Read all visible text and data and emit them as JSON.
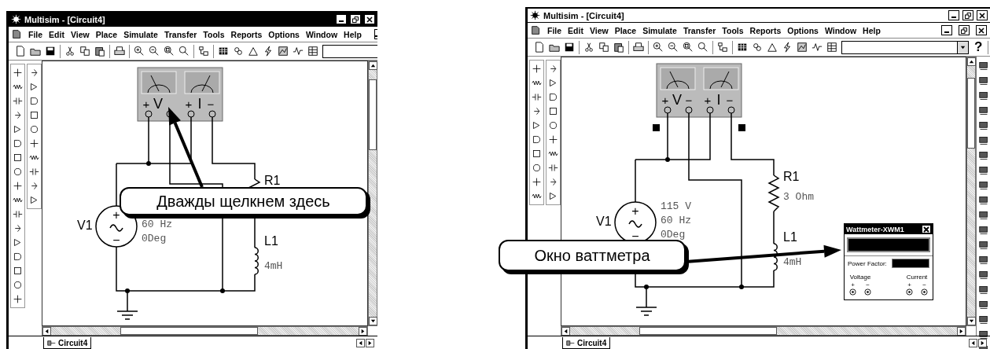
{
  "panels": [
    {
      "active": true,
      "title": "Multisim - [Circuit4]",
      "menu": [
        "File",
        "Edit",
        "View",
        "Place",
        "Simulate",
        "Transfer",
        "Tools",
        "Reports",
        "Options",
        "Window",
        "Help"
      ],
      "meter": {
        "selected": false,
        "voltage": [
          "+",
          "V"
        ],
        "current": [
          "+",
          "I",
          "−"
        ]
      },
      "source": {
        "name": "V1",
        "plus": "+",
        "minus": "−",
        "values": [
          "60 Hz",
          "0Deg"
        ]
      },
      "resistor": {
        "name": "R1"
      },
      "inductor": {
        "name": "L1",
        "values": [
          "4mH"
        ]
      },
      "callout": "Дважды щелкнем здесь",
      "tab": "Circuit4"
    },
    {
      "active": false,
      "title": "Multisim - [Circuit4]",
      "menu": [
        "File",
        "Edit",
        "View",
        "Place",
        "Simulate",
        "Transfer",
        "Tools",
        "Reports",
        "Options",
        "Window",
        "Help"
      ],
      "help": "?",
      "meter": {
        "selected": true,
        "voltage": [
          "+",
          "V",
          "−"
        ],
        "current": [
          "+",
          "I",
          "−"
        ]
      },
      "source": {
        "name": "V1",
        "plus": "+",
        "minus": "−",
        "values": [
          "115 V",
          "60 Hz",
          "0Deg"
        ]
      },
      "resistor": {
        "name": "R1",
        "values": [
          "3 Ohm"
        ]
      },
      "inductor": {
        "name": "L1",
        "values": [
          "4mH"
        ]
      },
      "callout": "Окно ваттметра",
      "wattmeter_window": {
        "title": "Wattmeter-XWM1",
        "power_factor_label": "Power Factor:",
        "groups": [
          {
            "label": "Voltage",
            "plus": "+",
            "minus": "−"
          },
          {
            "label": "Current",
            "plus": "+",
            "minus": "−"
          }
        ]
      },
      "tab": "Circuit4"
    }
  ]
}
